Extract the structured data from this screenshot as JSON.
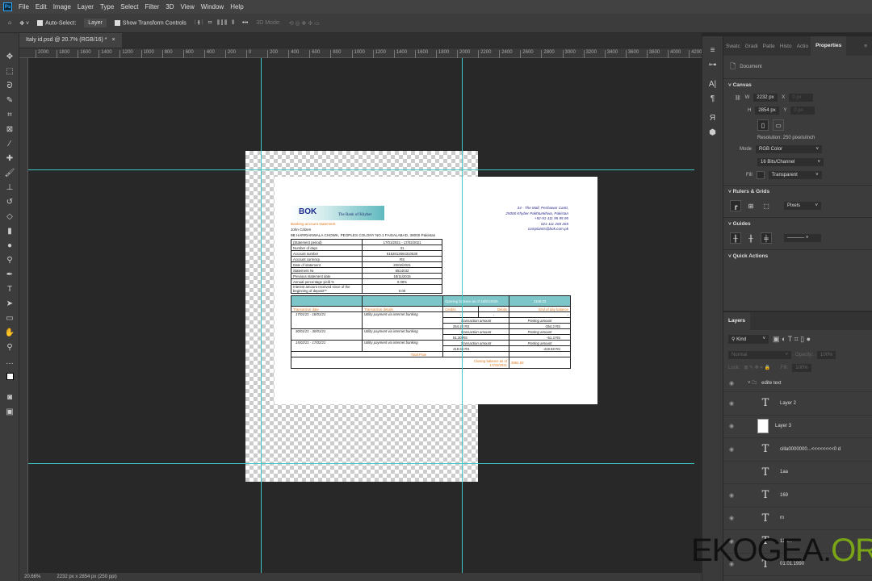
{
  "menu": {
    "logo": "Ps",
    "items": [
      "File",
      "Edit",
      "Image",
      "Layer",
      "Type",
      "Select",
      "Filter",
      "3D",
      "View",
      "Window",
      "Help"
    ]
  },
  "options": {
    "auto_select": "Auto-Select:",
    "layer_select": "Layer",
    "show_transform": "Show Transform Controls",
    "more": "•••",
    "mode_3d": "3D Mode:"
  },
  "tab": {
    "title": "Italy id.psd @ 20.7% (RGB/16) *",
    "close": "×"
  },
  "ruler_top": [
    "2000",
    "1800",
    "1600",
    "1400",
    "1200",
    "1000",
    "800",
    "600",
    "400",
    "200",
    "0",
    "200",
    "400",
    "600",
    "800",
    "1000",
    "1200",
    "1400",
    "1600",
    "1800",
    "2000",
    "2200",
    "2400",
    "2600",
    "2800",
    "3000",
    "3200",
    "3400",
    "3600",
    "3800",
    "4000",
    "4200"
  ],
  "doc": {
    "bank_name": "The Bank of Khyber",
    "logo": "BOK",
    "address": [
      "34 - The Mall, Peshawar Cantt,",
      "25000 Khyber Pakhtunkhwa, Pakistan",
      "+92-91-111 95 95 95",
      "021-111 265 265",
      "complaints@bok.com.pk"
    ],
    "title": "Banking account statement",
    "holder": "John Citizen",
    "holder_address": "9B HARRIANWALA CHOWK, PEOPLES COLONY NO.1 FAISALABAD, 38000 Pakistan",
    "summary": [
      [
        "(Statement period)",
        "17/01/2021 - 17/02/2021"
      ],
      [
        "Number of days",
        "31"
      ],
      [
        "Account number",
        "6152812664310530"
      ],
      [
        "Account currency",
        "RS"
      ],
      [
        "Date of statement",
        "20/02/2021"
      ],
      [
        "Statement №",
        "6514032"
      ],
      [
        "Previous statement date",
        "18/11/2015"
      ],
      [
        "Annual percentage yield %",
        "0.08%"
      ],
      [
        "Interest amount received since of the beginning of deposit**",
        "0.00"
      ]
    ],
    "opening_label": "Opening  balance as of 16/01/2026",
    "opening_value": "3108.03",
    "headers": [
      "Transaction date",
      "Transaction details",
      "Credits",
      "Debits",
      "End of day balance"
    ],
    "transactions": [
      {
        "date": "17/01/21 - 18/01/21",
        "details": "Utility payment via internet banking",
        "c1": "-",
        "c2": "-",
        "b1": "-",
        "label_a": "Transaction amount",
        "label_b": "Posting amount",
        "amount": "254.20  RS",
        "posting": "-254.2  RS"
      },
      {
        "date": "30/01/21 - 30/01/21",
        "details": "Utility payment via internet banking",
        "label_a": "Transaction amount",
        "label_b": "Posting amount",
        "amount": "51.30  RS",
        "posting": "-51.3  RS"
      },
      {
        "date": "15/02/21 - 17/02/21",
        "details": "Utility  payment via internet banking",
        "label_a": "Transaction amount",
        "label_b": "Posting amount",
        "amount": "419.68  RS",
        "posting": "-419.68  RS"
      }
    ],
    "total_flow": "Total Flow",
    "closing_label": "Closing balance as of 17/02/2021",
    "closing_value": "2864.83"
  },
  "panel": {
    "tabs": [
      "Swatc",
      "Gradi",
      "Patte",
      "Histo",
      "Actio",
      "Properties"
    ],
    "document": "Document",
    "canvas": "Canvas",
    "w_label": "W",
    "w": "2232 px",
    "h_label": "H",
    "h": "2854 px",
    "x_label": "X",
    "x": "0 px",
    "y_label": "Y",
    "y": "0 px",
    "resolution": "Resolution: 250 pixels/inch",
    "mode_label": "Mode",
    "mode": "RGB Color",
    "depth": "16 Bits/Channel",
    "fill_label": "Fill",
    "fill": "Transparent",
    "rulers": "Rulers & Grids",
    "units": "Pixels",
    "guides": "Guides",
    "quick_actions": "Quick Actions"
  },
  "layers": {
    "title": "Layers",
    "kind": "Kind",
    "blend": "Normal",
    "opacity_label": "Opacity:",
    "opacity": "100%",
    "lock_label": "Lock:",
    "fill_label": "Fill:",
    "fill": "100%",
    "items": [
      {
        "name": "edite text",
        "type": "group"
      },
      {
        "name": "Layer 2",
        "type": "text"
      },
      {
        "name": "Layer 3",
        "type": "image"
      },
      {
        "name": "cilla0000000...<<<<<<<<0 d",
        "type": "text"
      },
      {
        "name": "1aa",
        "type": "text"
      },
      {
        "name": "169",
        "type": "text"
      },
      {
        "name": "m",
        "type": "text"
      },
      {
        "name": "125...",
        "type": "text"
      },
      {
        "name": "01.01.1990",
        "type": "text"
      }
    ]
  },
  "status": {
    "zoom": "20.66%",
    "size": "2232 px x 2854 px (250 ppi)"
  },
  "watermark": {
    "a": "EKOGEA.",
    "b": "ORG"
  }
}
